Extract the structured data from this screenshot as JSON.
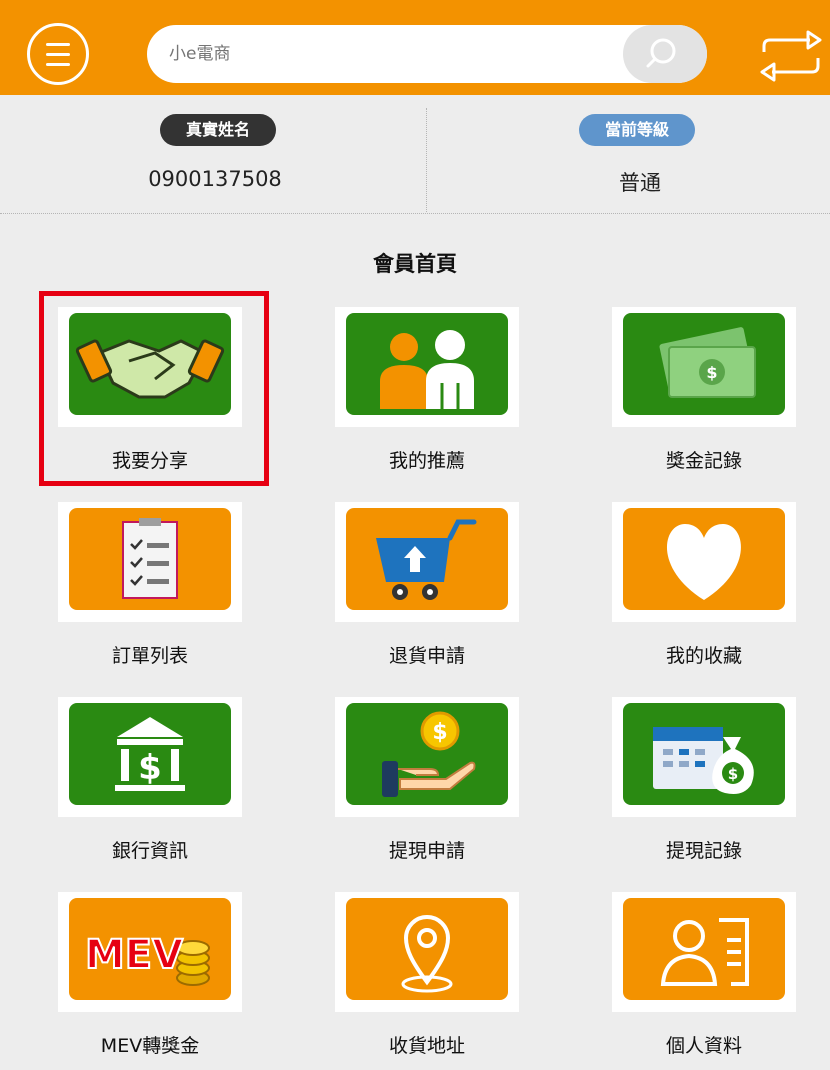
{
  "header": {
    "menu_icon": "hamburger-menu-icon",
    "search": {
      "value": "",
      "placeholder": "小e電商",
      "icon": "search-icon"
    },
    "swap_icon": "swap-arrows-icon",
    "colors": {
      "brand": "#f39200",
      "search_button": "#e3e3e3"
    }
  },
  "profile": {
    "name_label": "真實姓名",
    "name_value": "0900137508",
    "level_label": "當前等級",
    "level_value": "普通"
  },
  "section_title": "會員首頁",
  "tiles": [
    {
      "label": "我要分享",
      "icon": "handshake-icon",
      "color": "#2a8a12",
      "selected": true
    },
    {
      "label": "我的推薦",
      "icon": "people-icon",
      "color": "#2a8a12"
    },
    {
      "label": "獎金記錄",
      "icon": "money-icon",
      "color": "#2a8a12"
    },
    {
      "label": "訂單列表",
      "icon": "checklist-icon",
      "color": "#f39200"
    },
    {
      "label": "退貨申請",
      "icon": "cart-return-icon",
      "color": "#f39200"
    },
    {
      "label": "我的收藏",
      "icon": "heart-icon",
      "color": "#f39200"
    },
    {
      "label": "銀行資訊",
      "icon": "bank-icon",
      "color": "#2a8a12"
    },
    {
      "label": "提現申請",
      "icon": "hand-coin-icon",
      "color": "#2a8a12"
    },
    {
      "label": "提現記錄",
      "icon": "calendar-moneybag-icon",
      "color": "#2a8a12"
    },
    {
      "label": "MEV轉獎金",
      "icon": "mev-coins-icon",
      "color": "#f39200",
      "icon_text": "MEV"
    },
    {
      "label": "收貨地址",
      "icon": "location-pin-icon",
      "color": "#f39200"
    },
    {
      "label": "個人資料",
      "icon": "id-card-icon",
      "color": "#f39200"
    }
  ]
}
